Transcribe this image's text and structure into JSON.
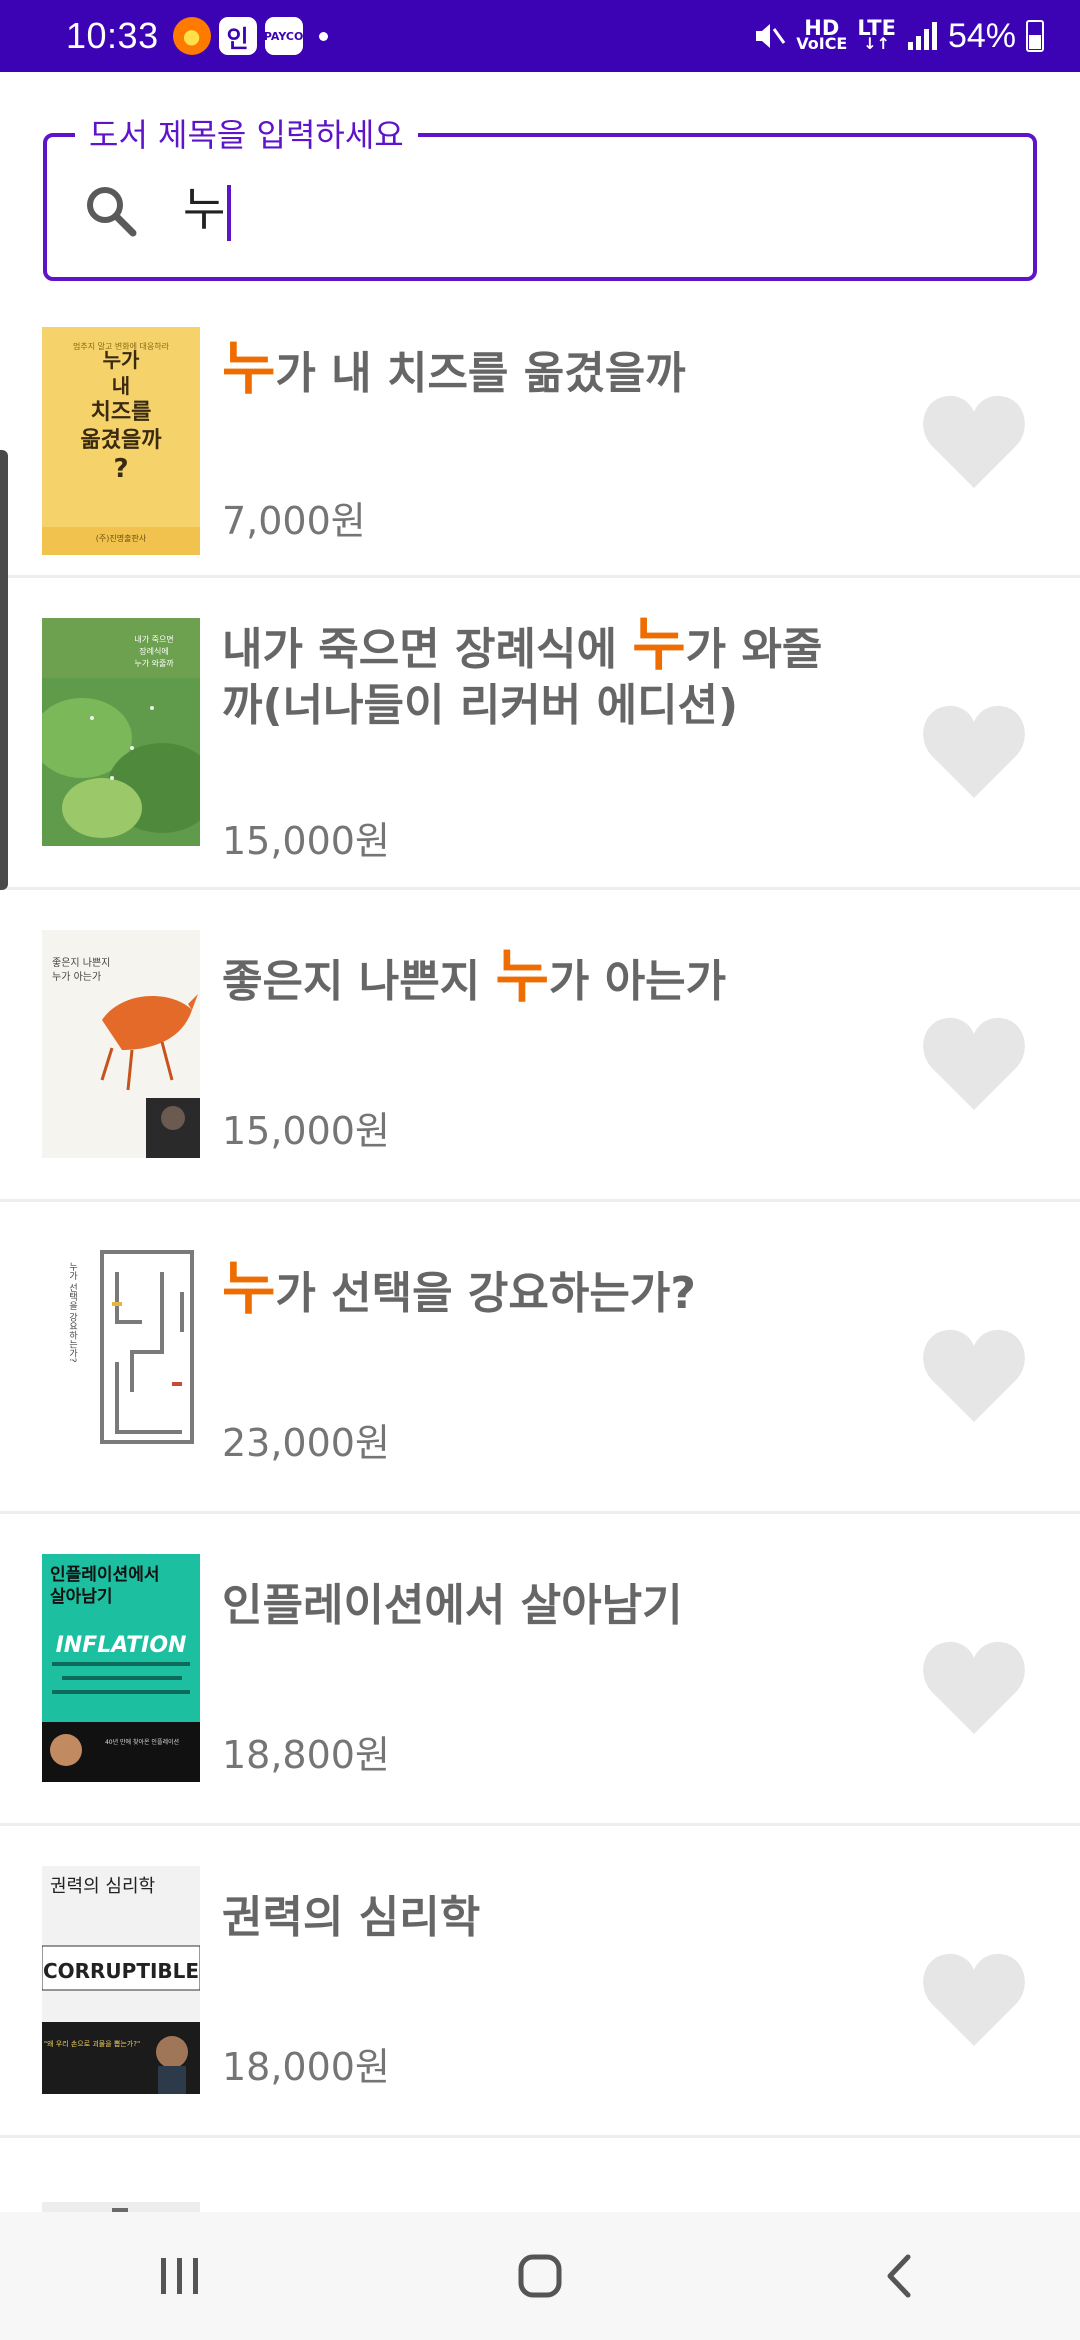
{
  "status_bar": {
    "time": "10:33",
    "apps": [
      "인",
      "PAYCO"
    ],
    "hd_label": "HD",
    "voice_label": "VoICE",
    "lte_label": "LTE",
    "battery": "54%"
  },
  "search": {
    "label": "도서 제목을 입력하세요",
    "value": "누"
  },
  "books": [
    {
      "highlight_before": "",
      "highlight": "누",
      "title_after": "가 내 치즈를 옮겼을까",
      "price": "7,000원",
      "cover_text": "누가\n내\n치즈를\n옮겼을까\n?",
      "favorited": false
    },
    {
      "highlight_before": "내가 죽으면 장례식에 ",
      "highlight": "누",
      "title_after": "가 와줄까(너나들이 리커버 에디션)",
      "price": "15,000원",
      "cover_text": "내가 죽으면\n장례식에\n누가 와줄까",
      "favorited": false
    },
    {
      "highlight_before": "좋은지 나쁜지 ",
      "highlight": "누",
      "title_after": "가 아는가",
      "price": "15,000원",
      "cover_text": "좋은지 나쁜지\n누가 아는가",
      "favorited": false
    },
    {
      "highlight_before": "",
      "highlight": "누",
      "title_after": "가 선택을 강요하는가?",
      "price": "23,000원",
      "cover_text": "누가 선택을 강요하는가?",
      "favorited": false
    },
    {
      "highlight_before": "",
      "highlight": "",
      "title_after": "인플레이션에서 살아남기",
      "price": "18,800원",
      "cover_text": "인플레이션에서\n살아남기",
      "cover_sub": "INFLATION",
      "favorited": false
    },
    {
      "highlight_before": "",
      "highlight": "",
      "title_after": "권력의 심리학",
      "price": "18,000원",
      "cover_text": "권력의 심리학",
      "cover_sub": "CORRUPTIBLE",
      "favorited": false
    }
  ],
  "colors": {
    "status_bar": "#3c03b4",
    "accent": "#5e14c9",
    "highlight": "#ef6c00",
    "heart": "#e6e6e6"
  },
  "icons": {
    "search": "search-icon",
    "heart": "heart-icon",
    "recents": "recents-icon",
    "home": "home-icon",
    "back": "back-icon"
  }
}
